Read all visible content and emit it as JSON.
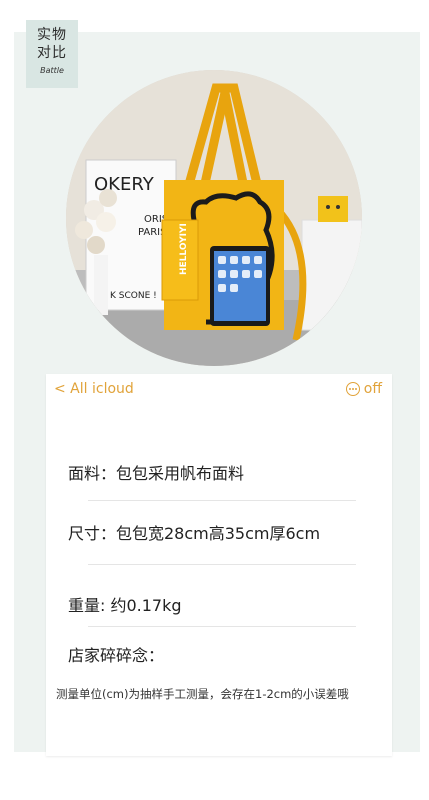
{
  "badge": {
    "line1": "实物",
    "line2": "对比",
    "sub": "Battle"
  },
  "photo": {
    "poster_text": "OKERY",
    "paris_text_1": "ORIS",
    "paris_text_2": "PARIS",
    "scone_text": "K SCONE !",
    "pouch_text": "HELLOYIYI",
    "bag_color": "#f2b515"
  },
  "topbar": {
    "back_label": "< All icloud",
    "off_label": "off"
  },
  "specs": {
    "material": "面料：包包采用帆布面料",
    "size": "尺寸：包包宽28cm高35cm厚6cm",
    "weight": "重量:  约0.17kg",
    "notes_title": "店家碎碎念：",
    "note": "测量单位(cm)为抽样手工测量，会存在1-2cm的小误差哦"
  },
  "colors": {
    "accent": "#e1a33a",
    "panel": "#eef3f1",
    "badge": "#d9e6e3"
  }
}
